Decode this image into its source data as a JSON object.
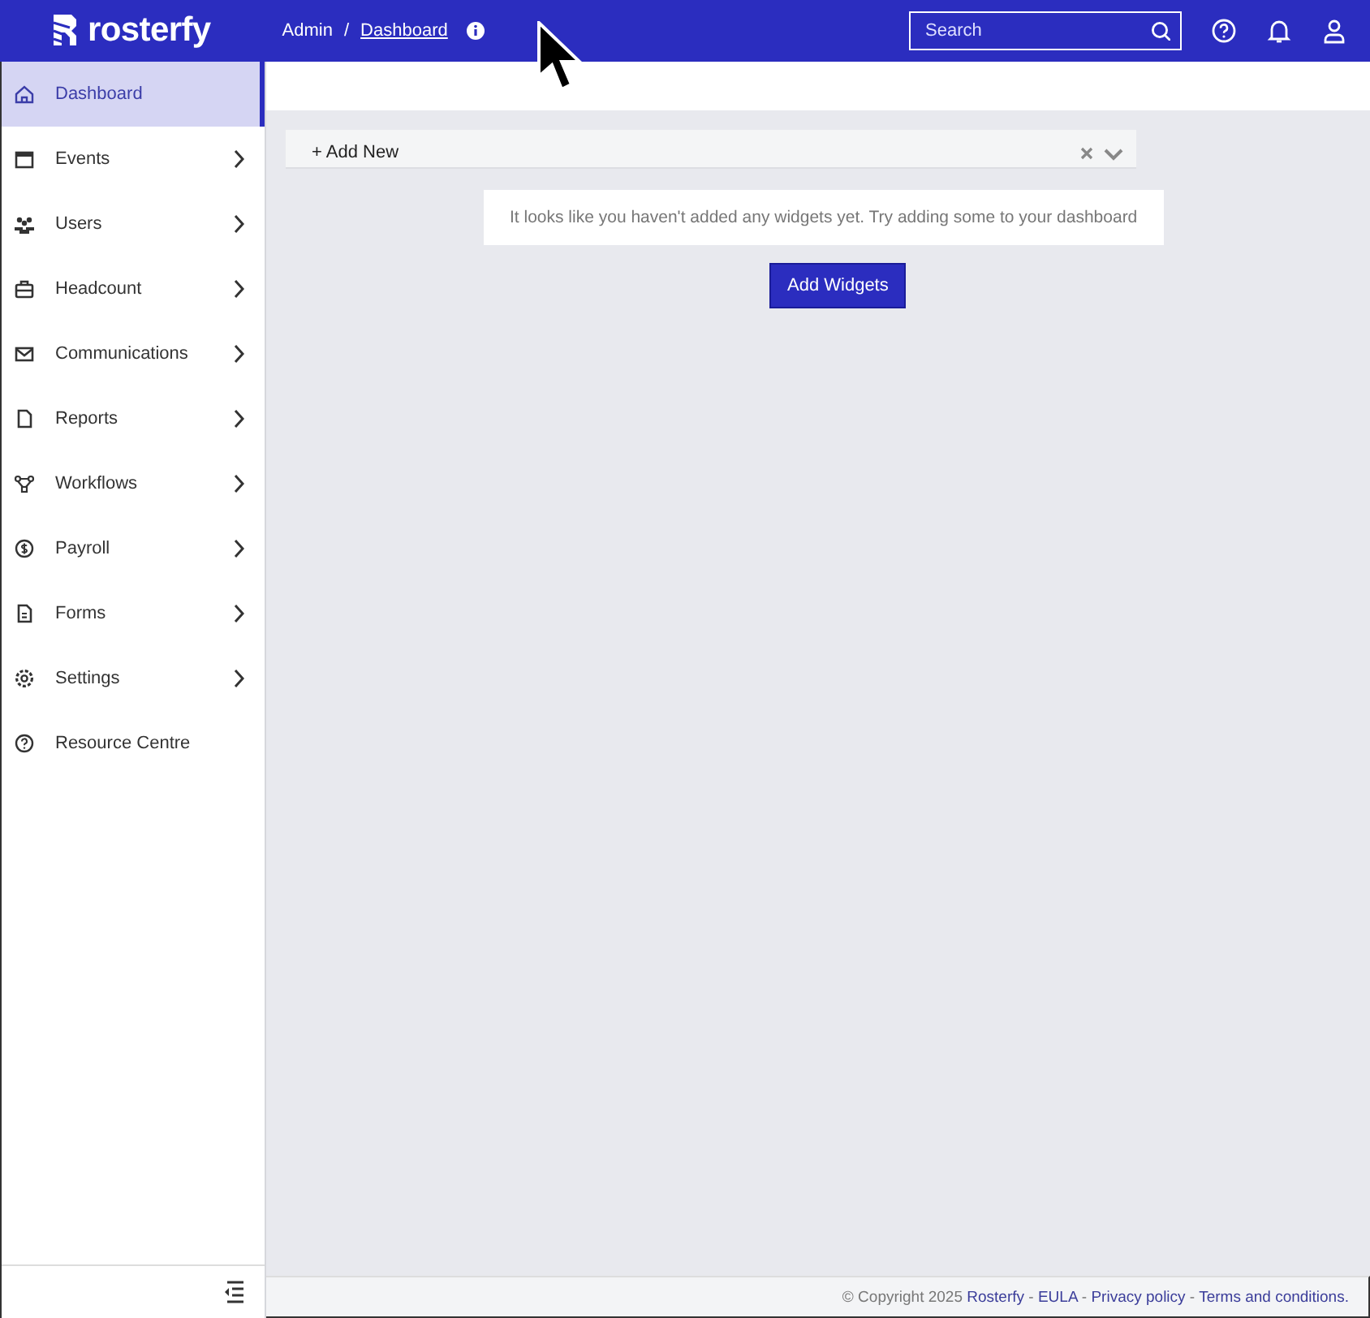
{
  "topbar": {
    "logo": "rosterfy",
    "breadcrumb": [
      {
        "label": "Admin",
        "kind": "text"
      },
      {
        "label": "/",
        "kind": "separator"
      },
      {
        "label": "Dashboard",
        "kind": "link"
      }
    ],
    "search": {
      "placeholder": "Search"
    }
  },
  "sidebar": {
    "items": [
      {
        "label": "Dashboard",
        "selected": true,
        "expandable": false
      },
      {
        "label": "Events",
        "selected": false,
        "expandable": true
      },
      {
        "label": "Users",
        "selected": false,
        "expandable": true
      },
      {
        "label": "Headcount",
        "selected": false,
        "expandable": true
      },
      {
        "label": "Communications",
        "selected": false,
        "expandable": true
      },
      {
        "label": "Reports",
        "selected": false,
        "expandable": true
      },
      {
        "label": "Workflows",
        "selected": false,
        "expandable": true
      },
      {
        "label": "Payroll",
        "selected": false,
        "expandable": true
      },
      {
        "label": "Forms",
        "selected": false,
        "expandable": true
      },
      {
        "label": "Settings",
        "selected": false,
        "expandable": true
      },
      {
        "label": "Resource Centre",
        "selected": false,
        "expandable": false
      }
    ]
  },
  "add_new": {
    "label": "+ Add New"
  },
  "empty_message": "It looks like you haven't added any widgets yet. Try adding some to your dashboard",
  "add_widgets_button": "Add Widgets",
  "footer": {
    "parts": [
      {
        "text": "© Copyright 2025 ",
        "kind": "text"
      },
      {
        "text": "Rosterfy",
        "kind": "link"
      },
      {
        "text": " - ",
        "kind": "text"
      },
      {
        "text": "EULA",
        "kind": "link"
      },
      {
        "text": " - ",
        "kind": "text"
      },
      {
        "text": "Privacy policy",
        "kind": "link"
      },
      {
        "text": " - ",
        "kind": "text"
      },
      {
        "text": "Terms and conditions.",
        "kind": "link"
      }
    ]
  }
}
